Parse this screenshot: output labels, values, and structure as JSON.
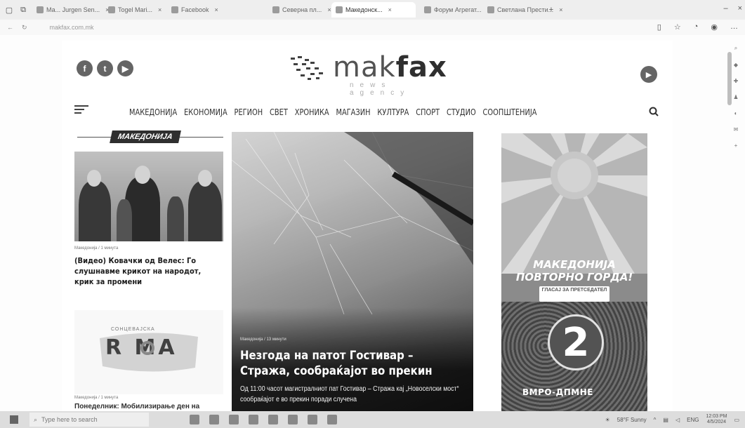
{
  "browser": {
    "tabs": [
      {
        "label": "Ма... Jurgen Sen..."
      },
      {
        "label": "Togel Mari..."
      },
      {
        "label": "Facebook"
      },
      {
        "label": "Северна пл..."
      },
      {
        "label": "Македонск..."
      },
      {
        "label": "Форум Агрегат..."
      },
      {
        "label": "Светлана Прести..."
      }
    ],
    "url": "makfax.com.mk"
  },
  "site": {
    "logo": {
      "name_light": "mak",
      "name_bold": "fax",
      "tagline": "news agency"
    },
    "social": [
      "f",
      "t",
      "▶"
    ],
    "nav": [
      "МАКЕДОНИЈА",
      "ЕКОНОМИЈА",
      "РЕГИОН",
      "СВЕТ",
      "ХРОНИКА",
      "МАГАЗИН",
      "КУЛТУРА",
      "СПОРТ",
      "СТУДИО",
      "СООПШТЕНИЈА"
    ],
    "section_label": "МАКЕДОНИЈА",
    "card1": {
      "meta": "Македонија / 1 минута",
      "title": "(Видео) Ковачки од Велес: Го слушнавме крикот на народот, крик за промени"
    },
    "card2": {
      "logo_small": "СОНЦЕВАЈСКА",
      "logo_big": "R MA",
      "meta": "Македонија / 1 минута",
      "title": "Понеделник: Мобилизирање ден на"
    },
    "hero": {
      "meta": "Македонија / 13 минути",
      "title": "Незгода на патот Гостивар – Стража, сообраќајот во прекин",
      "excerpt": "Од 11:00 часот магистралниот пат Гостивар – Стража кај „Новоселски мост“ сообраќајот е во прекин поради случена"
    },
    "ad": {
      "headline_1": "МАКЕДОНИЈА",
      "headline_2": "ПОВТОРНО ГОРДА!",
      "sub": "ГЛАСАЈ ЗА ПРЕТСЕДАТЕЛ",
      "number": "2",
      "brand": "ВМРО-ДПМНЕ"
    }
  },
  "taskbar": {
    "search_placeholder": "Type here to search",
    "weather": "58°F Sunny",
    "lang": "ENG",
    "time": "12:03 PM",
    "date": "4/5/2024"
  }
}
